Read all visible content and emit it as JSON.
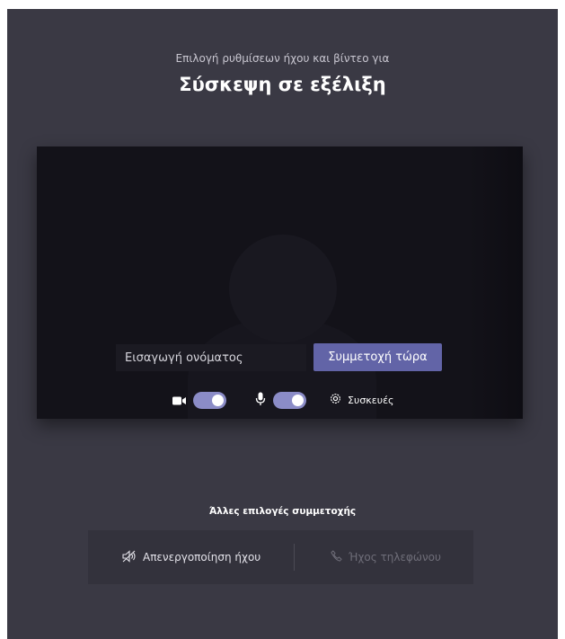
{
  "header": {
    "subtitle": "Επιλογή ρυθμίσεων ήχου και βίντεο για",
    "meeting_title": "Σύσκεψη σε εξέλιξη"
  },
  "preview": {
    "name_input": {
      "placeholder": "Εισαγωγή ονόματος",
      "value": ""
    },
    "join_button_label": "Συμμετοχή τώρα",
    "camera_toggle_on": true,
    "microphone_toggle_on": true,
    "devices_label": "Συσκευές"
  },
  "other_options": {
    "heading": "Άλλες επιλογές συμμετοχής",
    "audio_off_label": "Απενεργοποίηση ήχου",
    "phone_audio_label": "Ήχος τηλεφώνου"
  },
  "colors": {
    "background": "#3a3944",
    "accent": "#6264a7",
    "toggle_on": "#8b8cc7",
    "video_bg": "#131219"
  },
  "icons": [
    "video-camera-icon",
    "microphone-icon",
    "gear-icon",
    "speaker-off-icon",
    "phone-icon"
  ]
}
